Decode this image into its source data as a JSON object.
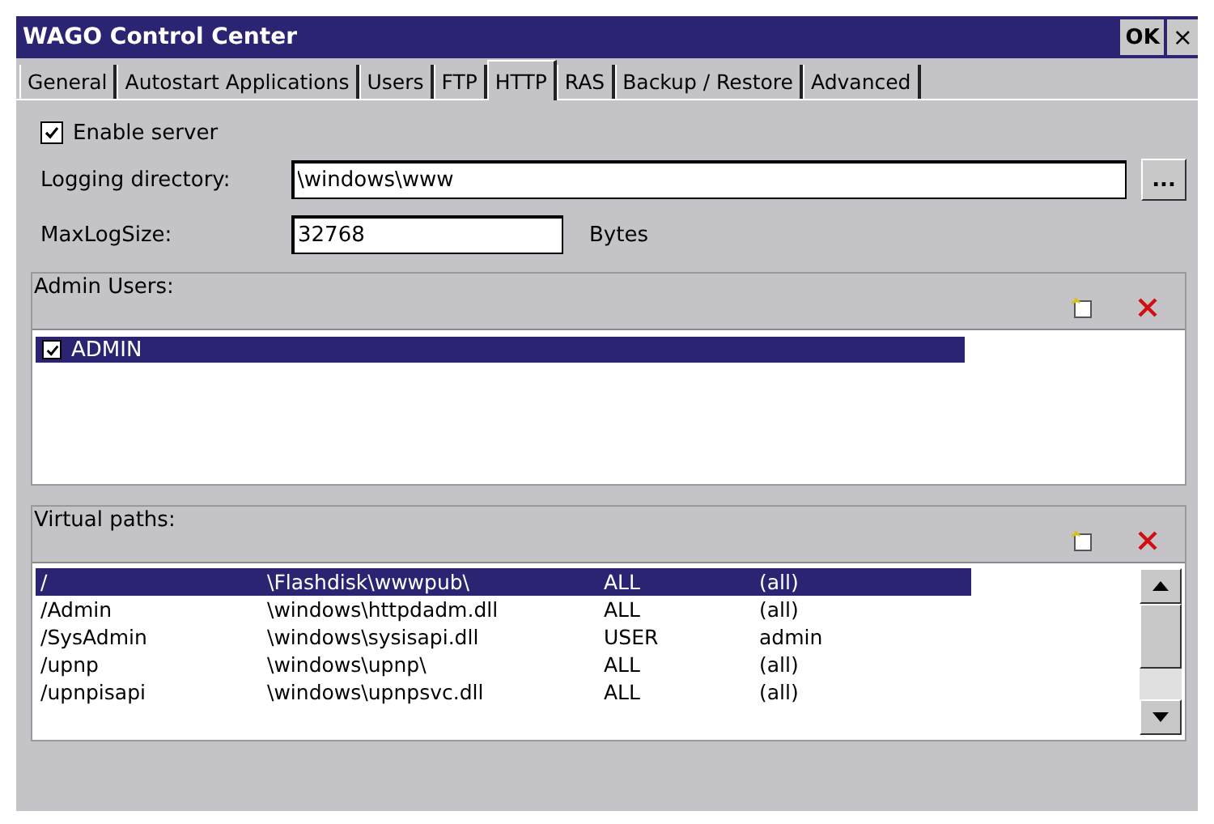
{
  "window": {
    "title": "WAGO Control Center",
    "ok_button": "OK",
    "close_button": "×"
  },
  "tabs": [
    {
      "label": "General",
      "selected": false
    },
    {
      "label": "Autostart Applications",
      "selected": false
    },
    {
      "label": "Users",
      "selected": false
    },
    {
      "label": "FTP",
      "selected": false
    },
    {
      "label": "HTTP",
      "selected": true
    },
    {
      "label": "RAS",
      "selected": false
    },
    {
      "label": "Backup / Restore",
      "selected": false
    },
    {
      "label": "Advanced",
      "selected": false
    }
  ],
  "enable_server": {
    "label": "Enable server",
    "checked": true
  },
  "logging_directory": {
    "label": "Logging directory:",
    "value": "\\windows\\www",
    "browse_button": "..."
  },
  "max_log_size": {
    "label": "MaxLogSize:",
    "value": "32768",
    "unit": "Bytes"
  },
  "admin_users": {
    "title": "Admin Users:",
    "items": [
      {
        "name": "ADMIN",
        "checked": true,
        "selected": true
      }
    ]
  },
  "virtual_paths": {
    "title": "Virtual paths:",
    "rows": [
      {
        "cells": [
          "/",
          "\\Flashdisk\\wwwpub\\",
          "ALL",
          "(all)"
        ],
        "selected": true
      },
      {
        "cells": [
          "/Admin",
          "\\windows\\httpdadm.dll",
          "ALL",
          "(all)"
        ],
        "selected": false
      },
      {
        "cells": [
          "/SysAdmin",
          "\\windows\\sysisapi.dll",
          "USER",
          "admin"
        ],
        "selected": false
      },
      {
        "cells": [
          "/upnp",
          "\\windows\\upnp\\",
          "ALL",
          "(all)"
        ],
        "selected": false
      },
      {
        "cells": [
          "/upnpisapi",
          "\\windows\\upnpsvc.dll",
          "ALL",
          "(all)"
        ],
        "selected": false
      }
    ]
  }
}
